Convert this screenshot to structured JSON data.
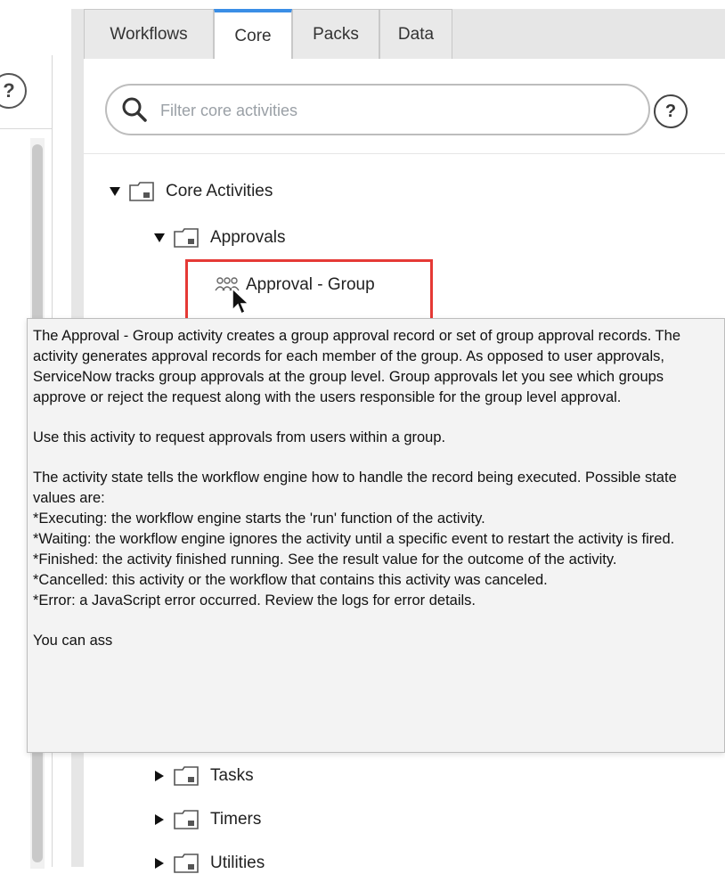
{
  "left": {
    "help_label": "?"
  },
  "tabs": [
    {
      "label": "Workflows",
      "active": false
    },
    {
      "label": "Core",
      "active": true
    },
    {
      "label": "Packs",
      "active": false
    },
    {
      "label": "Data",
      "active": false
    }
  ],
  "search": {
    "placeholder": "Filter core activities",
    "value": ""
  },
  "help_label": "?",
  "tree": {
    "root": "Core Activities",
    "approvals": "Approvals",
    "approval_group": "Approval - Group",
    "tasks": "Tasks",
    "timers": "Timers",
    "utilities": "Utilities"
  },
  "tooltip": {
    "para1": "The Approval - Group activity creates a group approval record or set of group approval records. The activity generates approval records for each member of the group. As opposed to user approvals, ServiceNow tracks group approvals at the group level. Group approvals let you see which groups approve or reject the request along with the users responsible for the group level approval.",
    "para2": "Use this activity to request approvals from users within a group.",
    "state_intro": "The activity state tells the workflow engine how to handle the record being executed. Possible state values are:",
    "state_executing": "*Executing: the workflow engine starts the 'run' function of the activity.",
    "state_waiting": "*Waiting: the workflow engine ignores the activity until a specific event to restart the activity is fired.",
    "state_finished": "*Finished: the activity finished running. See the result value for the outcome of the activity.",
    "state_cancelled": "*Cancelled: this activity or the workflow that contains this activity was canceled.",
    "state_error": "*Error: a JavaScript error occurred. Review the logs for error details.",
    "trailing": "You can ass"
  },
  "colors": {
    "active_tab": "#3a8ee6",
    "highlight": "#e53935"
  }
}
